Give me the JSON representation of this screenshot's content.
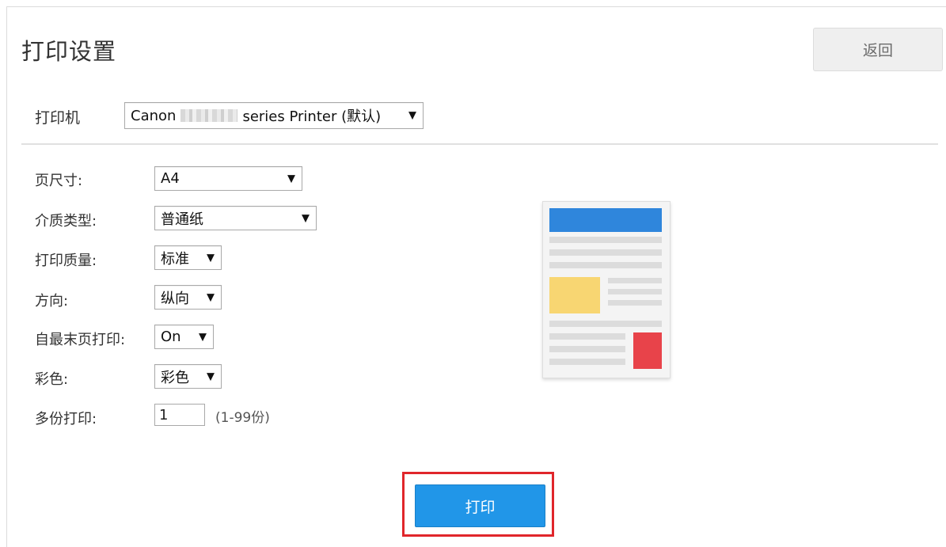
{
  "header": {
    "title": "打印设置",
    "back_label": "返回"
  },
  "printer": {
    "label": "打印机",
    "value_prefix": "Canon",
    "value_suffix": "series Printer (默认)"
  },
  "settings": {
    "page_size": {
      "label": "页尺寸:",
      "value": "A4"
    },
    "media_type": {
      "label": "介质类型:",
      "value": "普通纸"
    },
    "print_quality": {
      "label": "打印质量:",
      "value": "标准"
    },
    "orientation": {
      "label": "方向:",
      "value": "纵向"
    },
    "last_page_first": {
      "label": "自最末页打印:",
      "value": "On"
    },
    "color": {
      "label": "彩色:",
      "value": "彩色"
    },
    "copies": {
      "label": "多份打印:",
      "value": "1",
      "hint": "(1-99份)"
    }
  },
  "actions": {
    "print_label": "打印"
  },
  "icons": {
    "dropdown": "triangle-down-icon"
  },
  "colors": {
    "primary": "#2196e8",
    "highlight": "#e0262b",
    "preview_blue": "#2f86dc",
    "preview_yellow": "#f8d672",
    "preview_red": "#e8434a"
  }
}
